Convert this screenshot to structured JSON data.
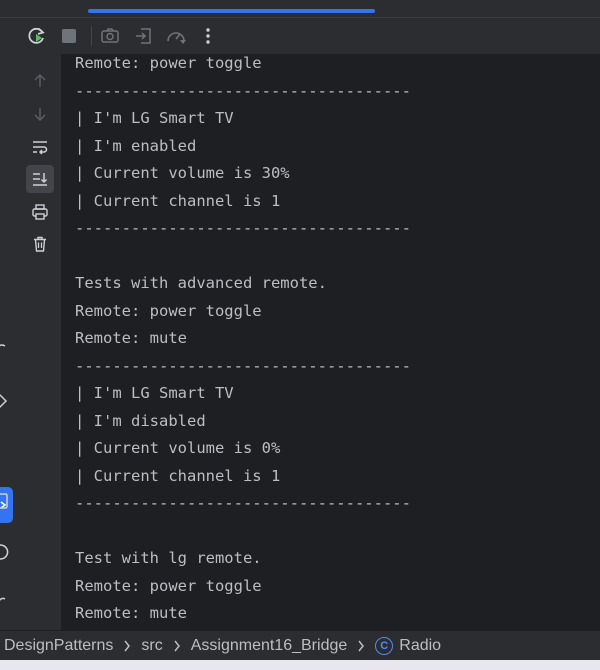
{
  "toolbar": {
    "buttons": [
      {
        "icon": "rerun-icon",
        "enabled": true
      },
      {
        "icon": "stop-icon",
        "enabled": false
      },
      {
        "icon": "camera-icon",
        "enabled": false
      },
      {
        "icon": "exit-icon",
        "enabled": false
      },
      {
        "icon": "profiler-icon",
        "enabled": false
      },
      {
        "icon": "more-icon",
        "enabled": true
      }
    ]
  },
  "side_rail": {
    "buttons": [
      {
        "icon": "arrow-up-icon",
        "enabled": false
      },
      {
        "icon": "arrow-down-icon",
        "enabled": false
      },
      {
        "icon": "soft-wrap-icon",
        "enabled": true
      },
      {
        "icon": "scroll-to-end-icon",
        "enabled": true,
        "active": true
      },
      {
        "icon": "print-icon",
        "enabled": true
      },
      {
        "icon": "trash-icon",
        "enabled": true
      }
    ]
  },
  "console": {
    "lines": [
      "Remote: power toggle",
      "------------------------------------",
      "| I'm LG Smart TV",
      "| I'm enabled",
      "| Current volume is 30%",
      "| Current channel is 1",
      "------------------------------------",
      "",
      "Tests with advanced remote.",
      "Remote: power toggle",
      "Remote: mute",
      "------------------------------------",
      "| I'm LG Smart TV",
      "| I'm disabled",
      "| Current volume is 0%",
      "| Current channel is 1",
      "------------------------------------",
      "",
      "Test with lg remote.",
      "Remote: power toggle",
      "Remote: mute"
    ]
  },
  "breadcrumb": {
    "project": "DesignPatterns",
    "folder": "src",
    "package": "Assignment16_Bridge",
    "class_icon_letter": "C",
    "class_name": "Radio"
  },
  "colors": {
    "accent": "#3574f0",
    "panel": "#2b2d30",
    "console_bg": "#1e1f22",
    "text": "#bcbec4",
    "rerun_green": "#5fb865",
    "disabled_icon": "#6f737a"
  }
}
